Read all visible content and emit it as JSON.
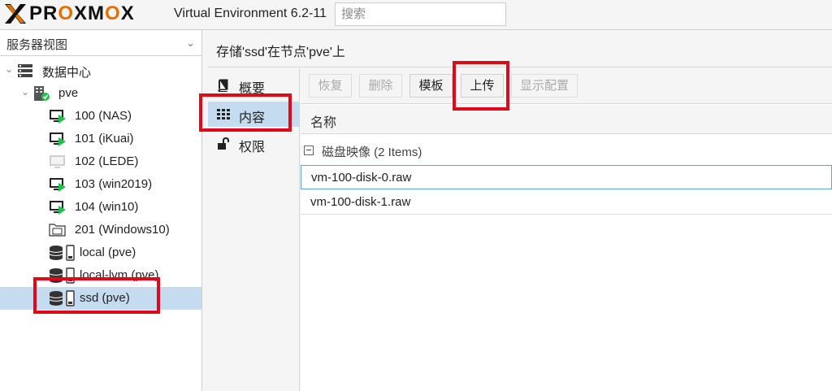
{
  "header": {
    "logo_text": "PROXMOX",
    "product_title": "Virtual Environment 6.2-11",
    "search_placeholder": "搜索"
  },
  "tree_panel": {
    "view_select": "服务器视图",
    "nodes": [
      {
        "label": "数据中心",
        "icon": "datacenter-icon"
      },
      {
        "label": "pve",
        "icon": "node-online-icon"
      },
      {
        "label": "100 (NAS)",
        "icon": "vm-running-icon"
      },
      {
        "label": "101 (iKuai)",
        "icon": "vm-running-icon"
      },
      {
        "label": "102 (LEDE)",
        "icon": "vm-stopped-icon"
      },
      {
        "label": "103 (win2019)",
        "icon": "vm-running-icon"
      },
      {
        "label": "104 (win10)",
        "icon": "vm-running-icon"
      },
      {
        "label": "201 (Windows10)",
        "icon": "template-icon"
      },
      {
        "label": "local (pve)",
        "icon": "storage-icon"
      },
      {
        "label": "local-lvm (pve)",
        "icon": "storage-icon"
      },
      {
        "label": "ssd (pve)",
        "icon": "storage-icon",
        "selected": true
      }
    ]
  },
  "content": {
    "title": "存储'ssd'在节点'pve'上",
    "nav": [
      {
        "label": "概要",
        "icon": "book-icon"
      },
      {
        "label": "内容",
        "icon": "grid-icon",
        "active": true
      },
      {
        "label": "权限",
        "icon": "unlock-icon"
      }
    ],
    "toolbar": {
      "restore": "恢复",
      "remove": "删除",
      "template": "模板",
      "upload": "上传",
      "show_config": "显示配置"
    },
    "grid": {
      "column_name": "名称",
      "group_label": "磁盘映像 (2 Items)",
      "rows": [
        "vm-100-disk-0.raw",
        "vm-100-disk-1.raw"
      ]
    }
  },
  "colors": {
    "accent_orange": "#e57000",
    "selection_blue": "#c4dbf0",
    "highlight_red": "#e0081b",
    "running_green": "#21bf4b"
  }
}
